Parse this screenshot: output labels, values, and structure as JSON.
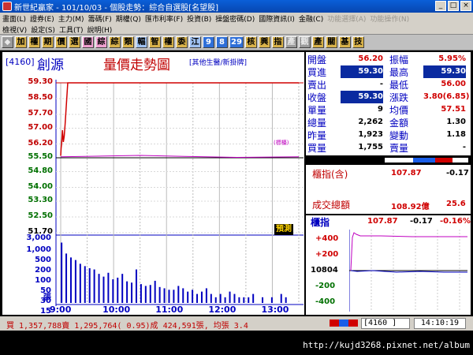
{
  "window": {
    "title": "新世紀贏家 - 101/10/03 - 個股走勢：綜合自選股[名望股]",
    "buttons": [
      "_",
      "□",
      "×"
    ]
  },
  "menu": {
    "row1": [
      "畫面(L)",
      "證券(E)",
      "主力(M)",
      "籌碼(F)",
      "期權(Q)",
      "匯市利率(F)",
      "投資(B)",
      "操盤密碼(D)",
      "國際資訊(I)",
      "金融(C)",
      "功能選擇(A)",
      "功能操作(N)"
    ],
    "row2": [
      "檢視(V)",
      "設定(S)",
      "工具(T)",
      "說明(H)"
    ]
  },
  "toolbar": {
    "buttons": [
      "◆",
      "加",
      "權",
      "期",
      "價",
      "選",
      "國",
      "綜",
      "綜",
      "類",
      "輻",
      "智",
      "權",
      "委",
      "江",
      "9",
      "8",
      "29",
      "核",
      "興",
      "指",
      "產",
      "觀",
      "產",
      "關",
      "基",
      "技"
    ]
  },
  "chart": {
    "code": "[4160]",
    "name": "創源",
    "title": "量價走勢圖",
    "subtitle": "[其他生醫/新掛牌]",
    "ref_tag": "(標檯)",
    "forecast_label": "預測",
    "price_ticks": [
      "59.30",
      "58.50",
      "57.70",
      "57.00",
      "56.20",
      "55.50",
      "54.80",
      "54.00",
      "53.30",
      "52.50",
      "51.70"
    ],
    "volume_ticks": [
      "3,000",
      "1,000",
      "500",
      "200",
      "100",
      "50",
      "30",
      "15",
      "張"
    ],
    "time_ticks": [
      "9:00",
      "10:00",
      "11:00",
      "12:00",
      "13:00"
    ]
  },
  "chart_data": {
    "type": "line",
    "ylim": [
      51.7,
      59.3
    ],
    "ylabel": "",
    "xlabel": "",
    "reference_price": 55.5,
    "price_series": [
      {
        "x": 0,
        "y": 55.6
      },
      {
        "x": 0.5,
        "y": 56.0
      },
      {
        "x": 1,
        "y": 56.2
      },
      {
        "x": 2,
        "y": 56.9
      },
      {
        "x": 3,
        "y": 56.3
      },
      {
        "x": 4,
        "y": 56.6
      },
      {
        "x": 5,
        "y": 57.2
      },
      {
        "x": 6,
        "y": 57.9
      },
      {
        "x": 7,
        "y": 58.6
      },
      {
        "x": 8,
        "y": 59.3
      },
      {
        "x": 270,
        "y": 59.3
      }
    ],
    "avg_series": [
      {
        "x": 0,
        "y": 55.55
      },
      {
        "x": 40,
        "y": 55.58
      },
      {
        "x": 90,
        "y": 55.62
      },
      {
        "x": 140,
        "y": 55.57
      },
      {
        "x": 200,
        "y": 55.52
      },
      {
        "x": 270,
        "y": 55.55
      }
    ],
    "volume": [
      1600,
      420,
      260,
      190,
      120,
      90,
      70,
      60,
      35,
      25,
      40,
      18,
      22,
      35,
      14,
      12,
      60,
      10,
      8,
      9,
      15,
      7,
      6,
      5,
      5,
      8,
      6,
      4,
      5,
      3,
      4,
      6,
      3,
      2,
      3,
      2,
      4,
      3,
      2,
      2,
      2,
      3,
      1,
      2,
      1,
      2,
      1,
      3,
      2,
      1
    ]
  },
  "quote": {
    "rows": [
      {
        "l": "開盤",
        "v": "56.20",
        "vc": "red",
        "r": "振幅",
        "rv": "5.95%",
        "rc": "red"
      },
      {
        "l": "買進",
        "v": "59.30",
        "vc": "hl",
        "r": "最高",
        "rv": "59.30",
        "rc": "hl"
      },
      {
        "l": "賣出",
        "v": "-",
        "vc": "black",
        "r": "最低",
        "rv": "56.00",
        "rc": "red"
      },
      {
        "l": "收盤",
        "v": "59.30",
        "vc": "hl",
        "r": "漲跌",
        "rv": "3.80(6.85)",
        "rc": "red"
      },
      {
        "l": "單量",
        "v": "9",
        "vc": "black",
        "r": "均價",
        "rv": "57.51",
        "rc": "red"
      },
      {
        "l": "總量",
        "v": "2,262",
        "vc": "black",
        "r": "金額",
        "rv": "1.30",
        "rc": "black"
      },
      {
        "l": "昨量",
        "v": "1,923",
        "vc": "black",
        "r": "變動",
        "rv": "1.18",
        "rc": "black"
      },
      {
        "l": "買量",
        "v": "1,755",
        "vc": "black",
        "r": "賣量",
        "rv": "-",
        "rc": "black"
      }
    ]
  },
  "index": {
    "label": "櫃指(含)",
    "value": "107.87",
    "change": "-0.17",
    "amount_label": "成交總額",
    "amount": "108.92億",
    "amount2": "25.6"
  },
  "mini": {
    "label": "櫃指",
    "value": "107.87",
    "change": "-0.17",
    "pct": "-0.16%",
    "ticks": [
      "+400",
      "+200",
      "10804",
      "-200",
      "-400"
    ]
  },
  "status": {
    "text": "買 1,357,788賣 1,295,764( 0.95)成 424,591張, 均張 3.4",
    "code": "[4160    ]",
    "time": "14:10:19"
  },
  "watermark": "http://kujd3268.pixnet.net/album",
  "colors": {
    "up": "#d00000",
    "down": "#007000",
    "price_line": "#d00000",
    "avg_line": "#c000c0",
    "volume": "#0000c0"
  }
}
